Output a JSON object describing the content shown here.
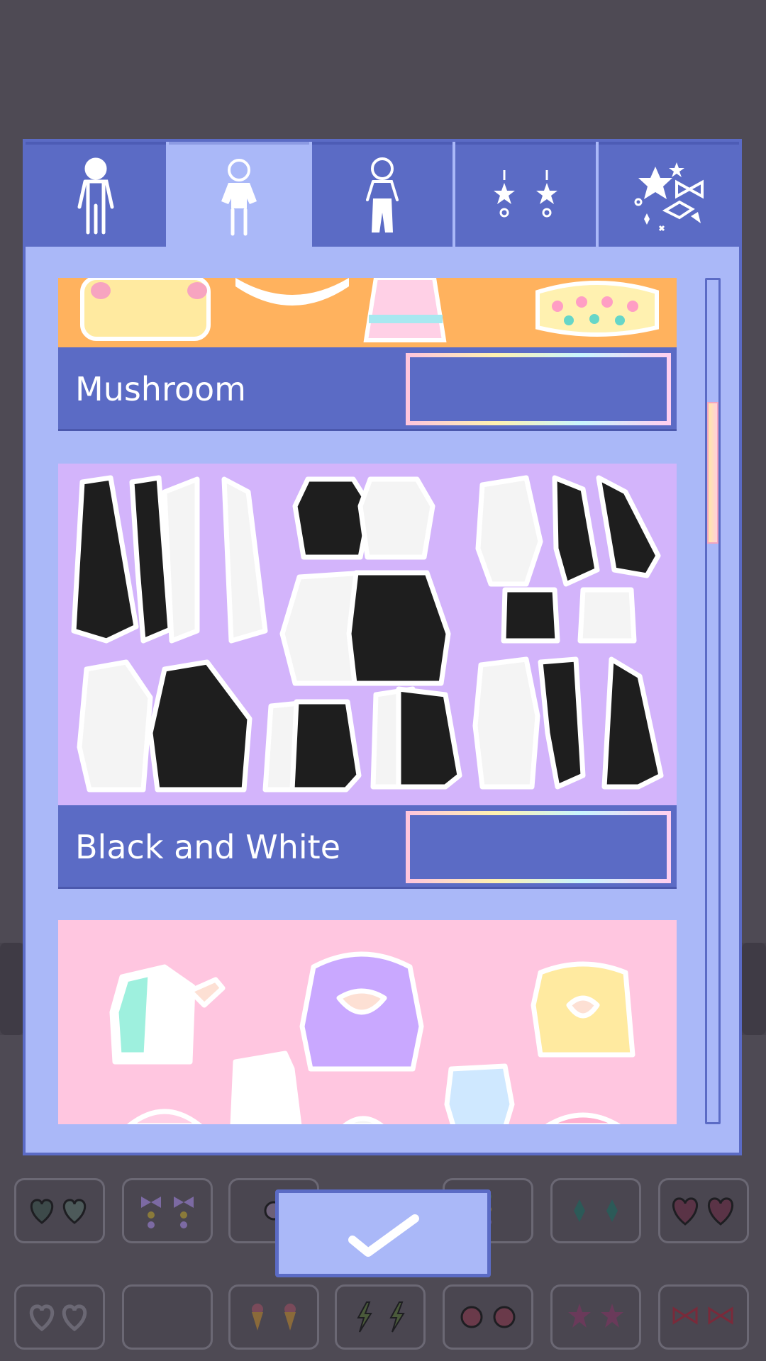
{
  "tabs": [
    {
      "icon": "body-base-icon",
      "active": false
    },
    {
      "icon": "top-clothing-icon",
      "active": true
    },
    {
      "icon": "bottom-clothing-icon",
      "active": false
    },
    {
      "icon": "earrings-icon",
      "active": false
    },
    {
      "icon": "sparkle-accessories-icon",
      "active": false
    }
  ],
  "packs": [
    {
      "name": "Mushroom",
      "image": "mushroom-pack-preview",
      "bg": "#ffb25e"
    },
    {
      "name": "Black and White",
      "image": "black-white-pack-preview",
      "bg": "#d3b4fb"
    },
    {
      "name": "",
      "image": "pastel-pack-preview",
      "bg": "#ffc6e0"
    }
  ],
  "confirm": {
    "icon": "checkmark-icon"
  },
  "colors": {
    "modal_bg": "#aab8f8",
    "accent": "#5b6bc5",
    "backdrop": "#4e4a54"
  }
}
